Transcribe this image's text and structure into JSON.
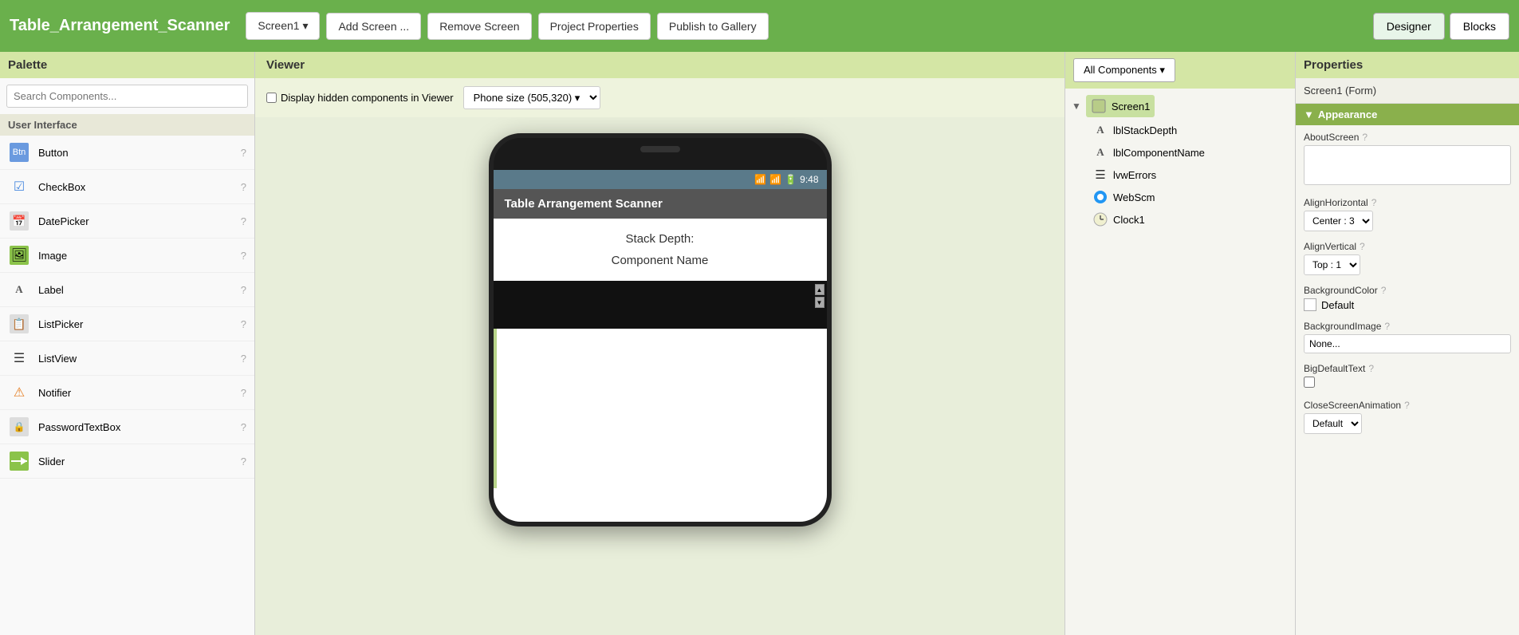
{
  "header": {
    "title": "Table_Arrangement_Scanner",
    "screen_btn": "Screen1 ▾",
    "add_screen": "Add Screen ...",
    "remove_screen": "Remove Screen",
    "project_properties": "Project Properties",
    "publish_to_gallery": "Publish to Gallery",
    "designer_btn": "Designer",
    "blocks_btn": "Blocks"
  },
  "palette": {
    "header": "Palette",
    "search_placeholder": "Search Components...",
    "section": "User Interface",
    "items": [
      {
        "id": "button",
        "label": "Button",
        "icon": "button"
      },
      {
        "id": "checkbox",
        "label": "CheckBox",
        "icon": "checkbox"
      },
      {
        "id": "datepicker",
        "label": "DatePicker",
        "icon": "datepicker"
      },
      {
        "id": "image",
        "label": "Image",
        "icon": "image"
      },
      {
        "id": "label",
        "label": "Label",
        "icon": "label"
      },
      {
        "id": "listpicker",
        "label": "ListPicker",
        "icon": "listpicker"
      },
      {
        "id": "listview",
        "label": "ListView",
        "icon": "listview"
      },
      {
        "id": "notifier",
        "label": "Notifier",
        "icon": "notifier"
      },
      {
        "id": "passwordtextbox",
        "label": "PasswordTextBox",
        "icon": "password"
      },
      {
        "id": "slider",
        "label": "Slider",
        "icon": "slider"
      }
    ]
  },
  "viewer": {
    "header": "Viewer",
    "hidden_components_label": "Display hidden components in Viewer",
    "phone_size": "Phone size (505,320)",
    "app_bar_title": "Table Arrangement Scanner",
    "label_stack_depth": "Stack Depth:",
    "label_component_name": "Component Name",
    "status_time": "9:48"
  },
  "components": {
    "all_components_btn": "All Components ▾",
    "tree": {
      "screen1": "Screen1",
      "children": [
        {
          "id": "lblStackDepth",
          "label": "lblStackDepth",
          "type": "label"
        },
        {
          "id": "lblComponentName",
          "label": "lblComponentName",
          "type": "label"
        },
        {
          "id": "lvwErrors",
          "label": "lvwErrors",
          "type": "listview"
        },
        {
          "id": "WebScm",
          "label": "WebScm",
          "type": "web"
        },
        {
          "id": "Clock1",
          "label": "Clock1",
          "type": "clock"
        }
      ]
    }
  },
  "properties": {
    "header": "Properties",
    "screen_label": "Screen1 (Form)",
    "appearance_header": "Appearance",
    "props": {
      "about_screen_label": "AboutScreen",
      "about_screen_value": "",
      "align_horizontal_label": "AlignHorizontal",
      "align_horizontal_value": "Center : 3",
      "align_vertical_label": "AlignVertical",
      "align_vertical_value": "Top : 1",
      "background_color_label": "BackgroundColor",
      "background_color_value": "Default",
      "background_image_label": "BackgroundImage",
      "background_image_value": "None...",
      "big_default_text_label": "BigDefaultText",
      "close_screen_animation_label": "CloseScreenAnimation",
      "close_screen_animation_value": "Default"
    }
  }
}
